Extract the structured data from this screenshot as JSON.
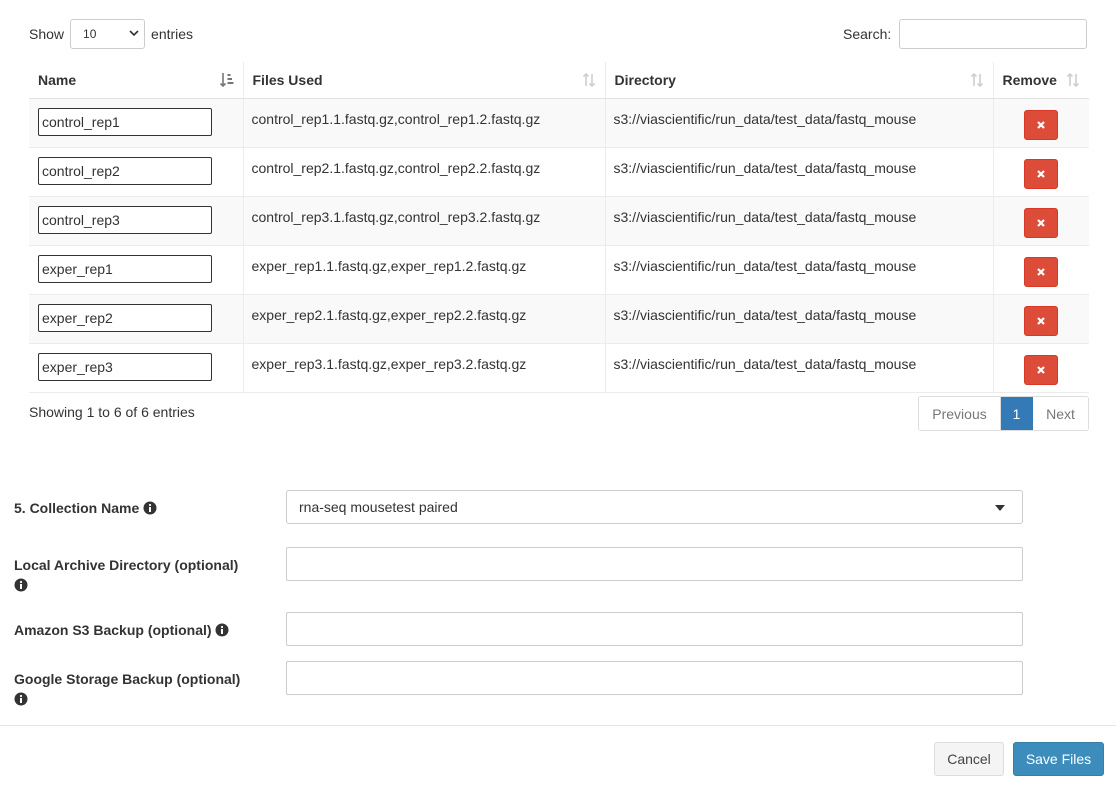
{
  "length_control": {
    "show_label": "Show",
    "selected": "10",
    "entries_label": "entries"
  },
  "search": {
    "label": "Search:",
    "value": ""
  },
  "table": {
    "columns": [
      "Name",
      "Files Used",
      "Directory",
      "Remove"
    ],
    "rows": [
      {
        "name": "control_rep1",
        "files": "control_rep1.1.fastq.gz,control_rep1.2.fastq.gz",
        "directory": "s3://viascientific/run_data/test_data/fastq_mouse"
      },
      {
        "name": "control_rep2",
        "files": "control_rep2.1.fastq.gz,control_rep2.2.fastq.gz",
        "directory": "s3://viascientific/run_data/test_data/fastq_mouse"
      },
      {
        "name": "control_rep3",
        "files": "control_rep3.1.fastq.gz,control_rep3.2.fastq.gz",
        "directory": "s3://viascientific/run_data/test_data/fastq_mouse"
      },
      {
        "name": "exper_rep1",
        "files": "exper_rep1.1.fastq.gz,exper_rep1.2.fastq.gz",
        "directory": "s3://viascientific/run_data/test_data/fastq_mouse"
      },
      {
        "name": "exper_rep2",
        "files": "exper_rep2.1.fastq.gz,exper_rep2.2.fastq.gz",
        "directory": "s3://viascientific/run_data/test_data/fastq_mouse"
      },
      {
        "name": "exper_rep3",
        "files": "exper_rep3.1.fastq.gz,exper_rep3.2.fastq.gz",
        "directory": "s3://viascientific/run_data/test_data/fastq_mouse"
      }
    ]
  },
  "table_info": "Showing 1 to 6 of 6 entries",
  "pagination": {
    "previous": "Previous",
    "current": "1",
    "next": "Next"
  },
  "form": {
    "collection_label": "5. Collection Name",
    "collection_value": "rna-seq mousetest paired",
    "local_archive_label": "Local Archive Directory (optional)",
    "local_archive_value": "",
    "s3_backup_label": "Amazon S3 Backup (optional)",
    "s3_backup_value": "",
    "gs_backup_label": "Google Storage Backup (optional)",
    "gs_backup_value": ""
  },
  "footer": {
    "cancel_label": "Cancel",
    "save_label": "Save Files"
  },
  "colors": {
    "remove_button": "#dd4b39",
    "primary_button": "#3c8dbc",
    "active_page": "#337ab7"
  }
}
